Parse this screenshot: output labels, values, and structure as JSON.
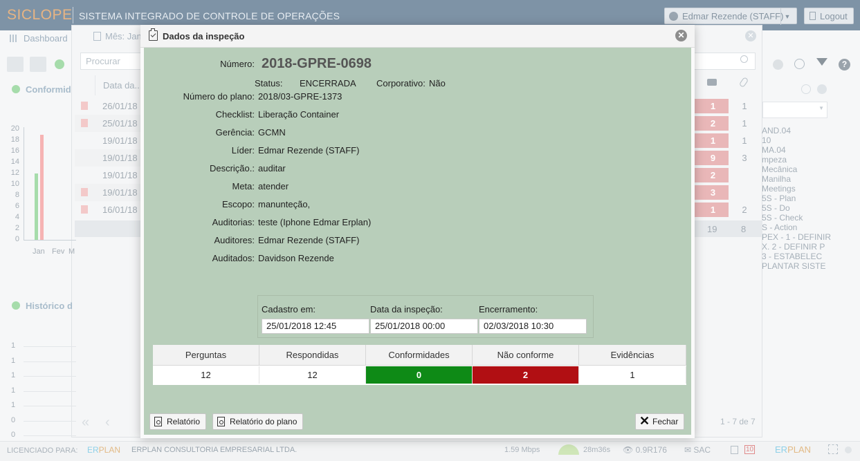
{
  "app": {
    "logo": "SICLOPE",
    "system_title": "SISTEMA INTEGRADO DE CONTROLE DE OPERAÇÕES",
    "user_label": "Edmar Rezende (STAFF)",
    "logout_label": "Logout"
  },
  "background": {
    "tab_dashboard": "Dashboard",
    "window_title": "Mês: Jan",
    "search_placeholder": "Procurar",
    "conformidade_label": "Conformid",
    "historico_label": "Histórico d",
    "table_header_date": "Data da...",
    "rows": [
      {
        "date": "26/01/18",
        "badge": "1",
        "count": "1",
        "pdf": true
      },
      {
        "date": "25/01/18",
        "badge": "2",
        "count": "1",
        "pdf": true
      },
      {
        "date": "19/01/18",
        "badge": "1",
        "count": "1",
        "pdf": false
      },
      {
        "date": "19/01/18",
        "badge": "9",
        "count": "3",
        "pdf": false
      },
      {
        "date": "19/01/18",
        "badge": "2",
        "count": "",
        "pdf": false
      },
      {
        "date": "19/01/18",
        "badge": "3",
        "count": "",
        "pdf": true
      },
      {
        "date": "16/01/18",
        "badge": "1",
        "count": "2",
        "pdf": true
      }
    ],
    "totals": {
      "badge_total": "19",
      "count_total": "8"
    },
    "right_list": [
      "AND.04",
      "10",
      "MA.04",
      "mpeza",
      "Mecânica",
      "Manilha",
      "Meetings",
      "5S - Plan",
      "5S - Do",
      "5S - Check",
      "S - Action",
      "PEX - 1 - DEFINIR",
      "X. 2 - DEFINIR P",
      "3 - ESTABELEC",
      "PLANTAR SISTE"
    ],
    "pager_info": "1 - 7 de 7",
    "chart_y_ticks": [
      "20",
      "18",
      "16",
      "14",
      "12",
      "10",
      "8",
      "6",
      "4",
      "2",
      "0"
    ],
    "chart_x_labels": [
      "Jan",
      "Fev",
      "M"
    ],
    "hist_y_ticks": [
      "1",
      "1",
      "1",
      "1",
      "1",
      "0",
      "0"
    ]
  },
  "chart_data": {
    "type": "bar",
    "categories": [
      "Jan"
    ],
    "series": [
      {
        "values": [
          12
        ],
        "color": "#a6dcab"
      },
      {
        "values": [
          19
        ],
        "color": "#f6b3b3"
      }
    ],
    "ylim": [
      0,
      20
    ]
  },
  "modal": {
    "title": "Dados da inspeção",
    "numero_label": "Número:",
    "numero_value": "2018-GPRE-0698",
    "status_label": "Status:",
    "status_value": "ENCERRADA",
    "corporativo_label": "Corporativo:",
    "corporativo_value": "Não",
    "fields": [
      {
        "label": "Número do plano:",
        "value": "2018/03-GPRE-1373"
      },
      {
        "label": "Checklist:",
        "value": "Liberação Container"
      },
      {
        "label": "Gerência:",
        "value": "GCMN"
      },
      {
        "label": "Líder:",
        "value": "Edmar Rezende (STAFF)"
      },
      {
        "label": "Descrição.:",
        "value": "auditar"
      },
      {
        "label": "Meta:",
        "value": "atender"
      },
      {
        "label": "Escopo:",
        "value": "manunteção,"
      },
      {
        "label": "Auditorias:",
        "value": "teste (Iphone Edmar Erplan)"
      },
      {
        "label": "Auditores:",
        "value": "Edmar Rezende (STAFF)"
      },
      {
        "label": "Auditados:",
        "value": "Davidson Rezende"
      }
    ],
    "dates": {
      "cadastro_label": "Cadastro em:",
      "cadastro_value": "25/01/2018 12:45",
      "inspecao_label": "Data da inspeção:",
      "inspecao_value": "25/01/2018 00:00",
      "encerramento_label": "Encerramento:",
      "encerramento_value": "02/03/2018 10:30"
    },
    "stats": {
      "headers": [
        "Perguntas",
        "Respondidas",
        "Conformidades",
        "Não conforme",
        "Evidências"
      ],
      "values": [
        "12",
        "12",
        "0",
        "2",
        "1"
      ]
    },
    "buttons": {
      "relatorio": "Relatório",
      "relatorio_plano": "Relatório do plano",
      "fechar": "Fechar"
    }
  },
  "footer": {
    "licenciado": "LICENCIADO PARA:",
    "erp_logo_a": "ER",
    "erp_logo_b": "PLAN",
    "company": "ERPLAN CONSULTORIA EMPRESARIAL LTDA.",
    "speed": "1.59 Mbps",
    "time": "28m36s",
    "version": "0.9R176",
    "sac": "SAC",
    "badge": "10"
  },
  "colors": {
    "modal_body": "#b8ceba",
    "conformidades": "#0e8a16",
    "nao_conforme": "#b10f13",
    "topbar": "#7e93a6"
  }
}
